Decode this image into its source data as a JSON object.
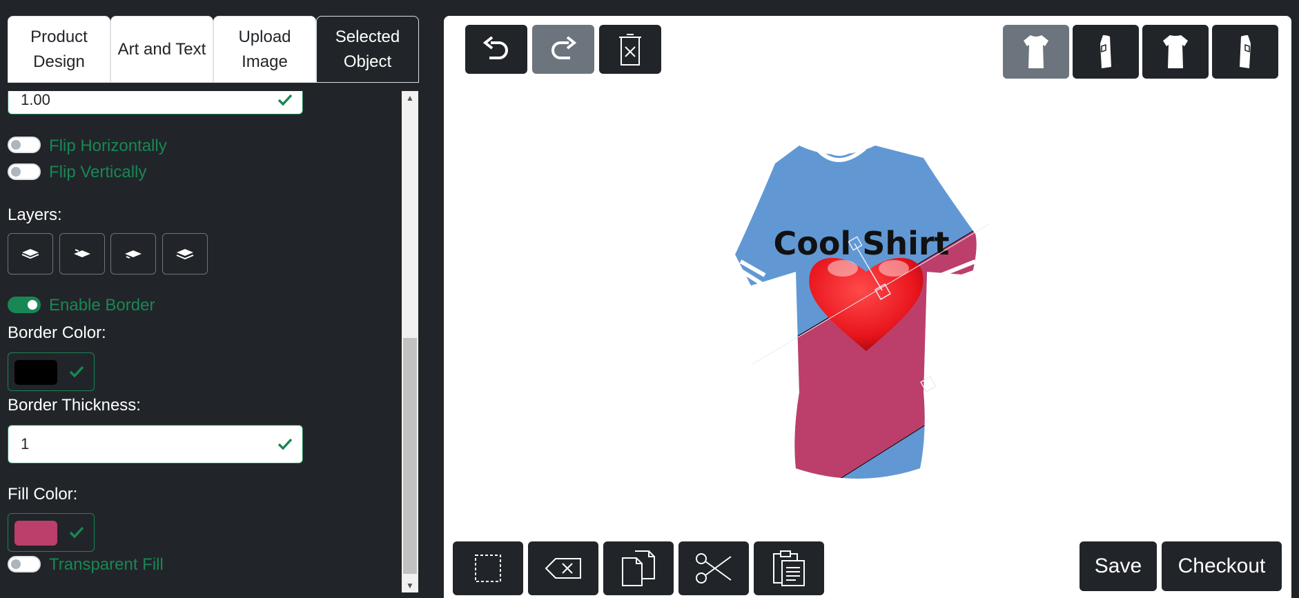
{
  "tabs": [
    {
      "label": "Product Design"
    },
    {
      "label": "Art and Text"
    },
    {
      "label": "Upload Image"
    },
    {
      "label": "Selected Object"
    }
  ],
  "panel": {
    "scale_value": "1.00",
    "flip_horizontal": {
      "label": "Flip Horizontally",
      "on": false
    },
    "flip_vertical": {
      "label": "Flip Vertically",
      "on": false
    },
    "layers_label": "Layers:",
    "enable_border": {
      "label": "Enable Border",
      "on": true
    },
    "border_color_label": "Border Color:",
    "border_color": "#000000",
    "border_thickness_label": "Border Thickness:",
    "border_thickness_value": "1",
    "fill_color_label": "Fill Color:",
    "fill_color": "#bc3f6b",
    "transparent_fill": {
      "label": "Transparent Fill",
      "on": false
    }
  },
  "toolbar": {
    "undo": "undo-icon",
    "redo": "redo-icon",
    "clear": "trash-clear-icon"
  },
  "views": [
    "front",
    "left-side",
    "back",
    "right-side"
  ],
  "design": {
    "shirt_color": "#6198d4",
    "stripe_color": "#bc3f6b",
    "text": "Cool Shirt",
    "heart_color": "#e8141c"
  },
  "bottom_tools": [
    "select-icon",
    "delete-icon",
    "copy-icon",
    "cut-icon",
    "paste-icon"
  ],
  "actions": {
    "save_label": "Save",
    "checkout_label": "Checkout"
  },
  "colors": {
    "accent": "#198754",
    "dark": "#212529",
    "muted": "#6c757d"
  }
}
